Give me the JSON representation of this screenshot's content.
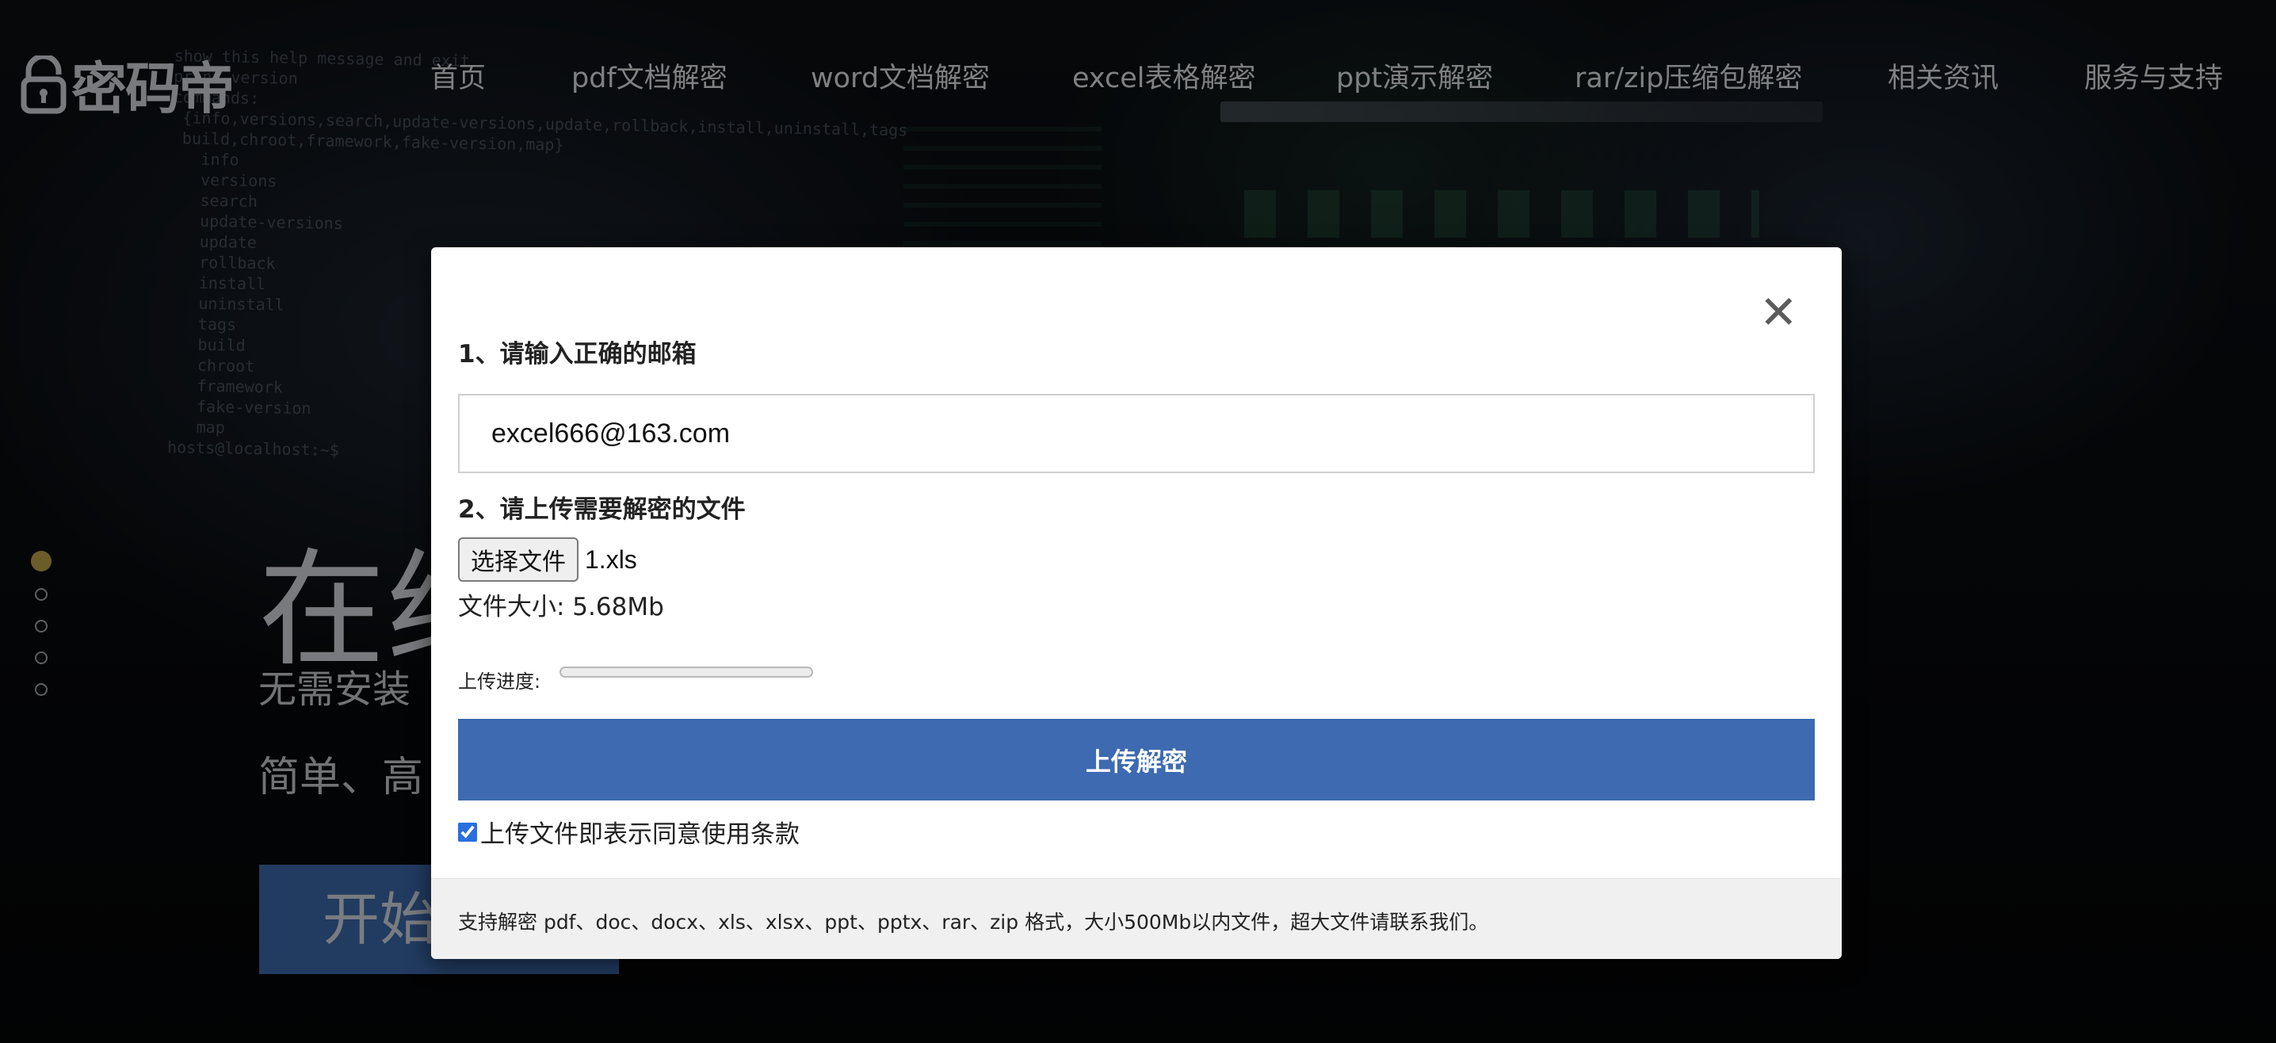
{
  "header": {
    "logo_text": "密码帝",
    "nav": [
      "首页",
      "pdf文档解密",
      "word文档解密",
      "excel表格解密",
      "ppt演示解密",
      "rar/zip压缩包解密",
      "相关资讯",
      "服务与支持"
    ]
  },
  "hero": {
    "title": "在线",
    "subtitle1": "无需安装",
    "subtitle2": "简单、高",
    "button_label": "开始",
    "slides_count": 5,
    "active_slide": 1
  },
  "terminal_text": "show this help message and exit\nprint version\ncommands:\n {info,versions,search,update-versions,update,rollback,install,uninstall,tags\n build,chroot,framework,fake-version,map}\n   info\n   versions\n   search\n   update-versions\n   update\n   rollback\n   install\n   uninstall\n   tags\n   build\n   chroot\n   framework\n   fake-version\n   map\nhosts@localhost:~$",
  "modal": {
    "close_symbol": "✕",
    "step1_label": "1、请输入正确的邮箱",
    "email_value": "excel666@163.com",
    "step2_label": "2、请上传需要解密的文件",
    "choose_file_label": "选择文件",
    "file_name": "1.xls",
    "file_size_text": "文件大小: 5.68Mb",
    "progress_label": "上传进度:",
    "progress_fraction": 0,
    "upload_button": "上传解密",
    "agree_checked": true,
    "agree_text": "上传文件即表示同意使用条款",
    "footer_text": "支持解密 pdf、doc、docx、xls、xlsx、ppt、pptx、rar、zip 格式，大小500Mb以内文件，超大文件请联系我们。"
  },
  "colors": {
    "primary": "#3d6ab0",
    "active_dot": "#b59a46",
    "footer_bg": "#f0f0f0"
  }
}
